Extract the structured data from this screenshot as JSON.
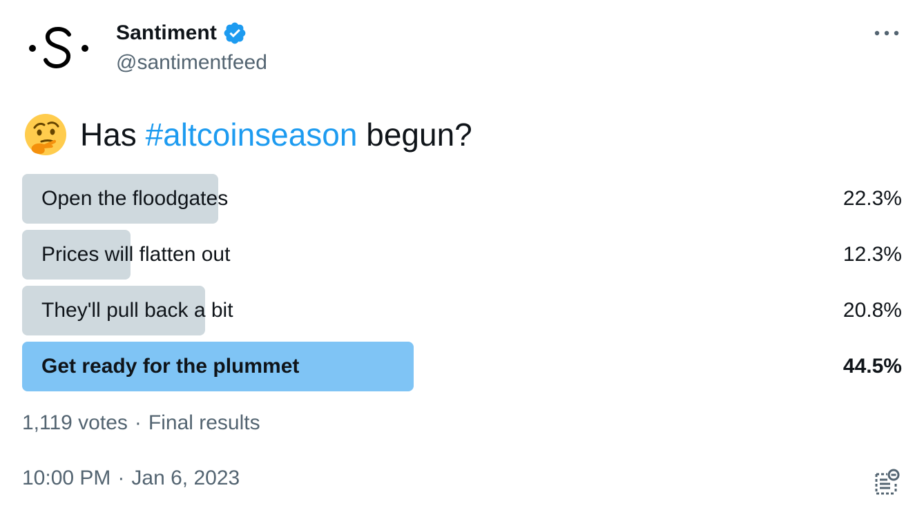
{
  "author": {
    "display_name": "Santiment",
    "handle": "@santimentfeed",
    "avatar_icon": "santiment-logo-icon",
    "verified_icon": "verified-badge-icon",
    "verified_color": "#1d9bf0"
  },
  "tweet": {
    "emoji": "thinking-face-icon",
    "text_before": "Has",
    "hashtag": "#altcoinseason",
    "text_after": "begun?"
  },
  "poll": {
    "options": [
      {
        "label": "Open the floodgates",
        "percent_text": "22.3%",
        "percent": 22.3,
        "winner": false
      },
      {
        "label": "Prices will flatten out",
        "percent_text": "12.3%",
        "percent": 12.3,
        "winner": false
      },
      {
        "label": "They'll pull back a bit",
        "percent_text": "20.8%",
        "percent": 20.8,
        "winner": false
      },
      {
        "label": "Get ready for the plummet",
        "percent_text": "44.5%",
        "percent": 44.5,
        "winner": true
      }
    ],
    "votes": "1,119 votes",
    "status": "Final results",
    "bar_color": "#cfd9de",
    "winner_bar_color": "#7fc4f5"
  },
  "footer": {
    "time": "10:00 PM",
    "date": "Jan 6, 2023",
    "separator": "·",
    "notes_icon": "community-notes-icon"
  },
  "header": {
    "more_icon": "more-options-icon"
  },
  "colors": {
    "text": "#0f1419",
    "secondary": "#536471",
    "accent": "#1d9bf0"
  }
}
